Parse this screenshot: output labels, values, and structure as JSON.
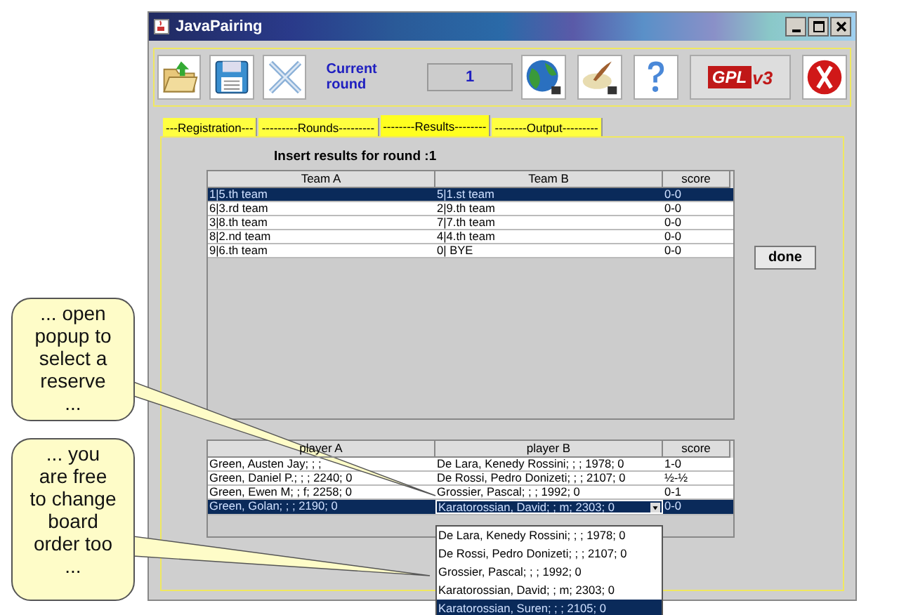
{
  "window": {
    "title": "JavaPairing"
  },
  "toolbar": {
    "buttons": [
      {
        "kind": "open"
      },
      {
        "kind": "save"
      },
      {
        "kind": "tools"
      }
    ],
    "round_label": "Current round",
    "round_value": "1",
    "buttons_right": [
      {
        "kind": "globe"
      },
      {
        "kind": "quill"
      },
      {
        "kind": "help"
      },
      {
        "kind": "license",
        "text": "GPL",
        "version": "v3"
      },
      {
        "kind": "exit"
      }
    ]
  },
  "tabs": [
    {
      "label": "---Registration---",
      "selected": false
    },
    {
      "label": "---------Rounds---------",
      "selected": false
    },
    {
      "label": "--------Results--------",
      "selected": true
    },
    {
      "label": "--------Output---------",
      "selected": false
    }
  ],
  "heading": "Insert results for round :1",
  "teams_table": {
    "columns": [
      "Team A",
      "Team B",
      "score"
    ],
    "rows": [
      {
        "cells": [
          "1|5.th team",
          "5|1.st team",
          "0-0"
        ],
        "selected": true
      },
      {
        "cells": [
          "6|3.rd team",
          "2|9.th team",
          "0-0"
        ],
        "selected": false
      },
      {
        "cells": [
          "3|8.th team",
          "7|7.th team",
          "0-0"
        ],
        "selected": false
      },
      {
        "cells": [
          "8|2.nd team",
          "4|4.th team",
          "0-0"
        ],
        "selected": false
      },
      {
        "cells": [
          "9|6.th team",
          "0| BYE",
          "0-0"
        ],
        "selected": false
      }
    ]
  },
  "done_button": "done",
  "players_table": {
    "columns": [
      "player A",
      "player B",
      "score"
    ],
    "rows": [
      {
        "cells": [
          "Green, Austen Jay; ; ;",
          "De Lara, Kenedy Rossini; ; ; 1978; 0",
          "1-0"
        ],
        "selected": false
      },
      {
        "cells": [
          "Green, Daniel P.; ; ; 2240; 0",
          "De Rossi, Pedro Donizeti; ; ; 2107; 0",
          "½-½"
        ],
        "selected": false
      },
      {
        "cells": [
          "Green, Ewen M; ; f; 2258; 0",
          "Grossier, Pascal; ; ; 1992; 0",
          "0-1"
        ],
        "selected": false
      },
      {
        "cells": [
          "Green, Golan; ; ; 2190; 0",
          "Karatorossian, David; ; m; 2303; 0",
          "0-0"
        ],
        "selected": true
      }
    ]
  },
  "popup": {
    "items": [
      {
        "label": "De Lara, Kenedy Rossini; ; ; 1978; 0",
        "selected": false
      },
      {
        "label": "De Rossi, Pedro Donizeti; ; ; 2107; 0",
        "selected": false
      },
      {
        "label": "Grossier, Pascal; ; ; 1992; 0",
        "selected": false
      },
      {
        "label": "Karatorossian, David; ; m; 2303; 0",
        "selected": false
      },
      {
        "label": "Karatorossian, Suren; ; ; 2105; 0",
        "selected": true
      }
    ]
  },
  "callouts": [
    {
      "text": "... open popup to select a reserve ..."
    },
    {
      "text": "... you are free to change board order too ..."
    }
  ]
}
